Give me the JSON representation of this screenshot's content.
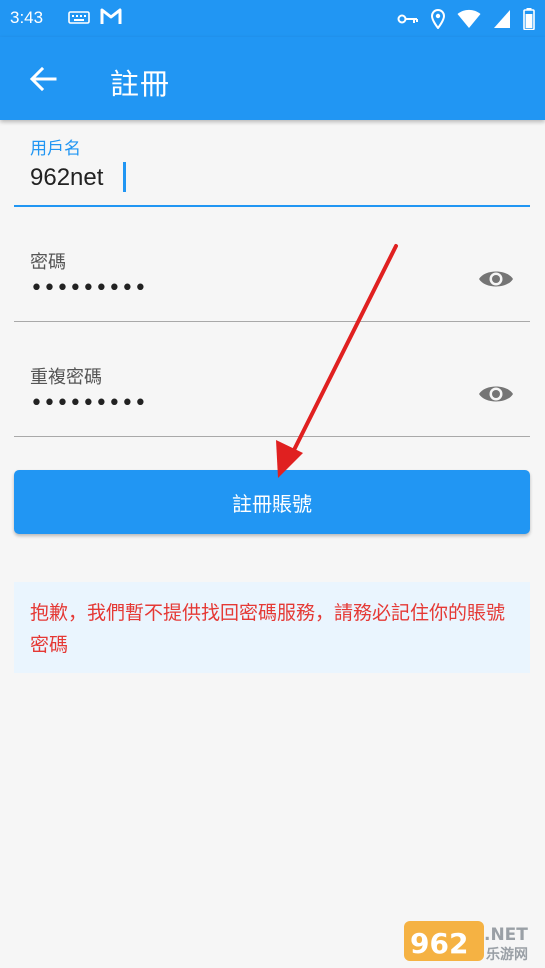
{
  "status_bar": {
    "time": "3:43",
    "left_icons": [
      "keyboard-icon",
      "gmail-icon"
    ],
    "right_icons": [
      "vpn-key-icon",
      "location-icon",
      "wifi-icon",
      "signal-icon",
      "battery-icon"
    ]
  },
  "app_bar": {
    "title": "註冊",
    "back_icon": "arrow-back-icon",
    "color": "#2196f3"
  },
  "form": {
    "username": {
      "label": "用戶名",
      "value": "962net"
    },
    "password": {
      "label": "密碼",
      "value": "•••••••••",
      "toggle_icon": "eye-icon"
    },
    "confirm_password": {
      "label": "重複密碼",
      "value": "•••••••••",
      "toggle_icon": "eye-icon"
    },
    "submit_label": "註冊賬號"
  },
  "notice": {
    "text": "抱歉，我們暫不提供找回密碼服務，請務必記住你的賬號密碼",
    "color": "#e53935"
  },
  "watermark": {
    "brand_number": "962",
    "brand_suffix": ".NET",
    "brand_subtitle": "乐游网"
  },
  "colors": {
    "accent": "#2196f3",
    "focus_underline": "#2196f3",
    "annotation_arrow": "#e02020"
  }
}
